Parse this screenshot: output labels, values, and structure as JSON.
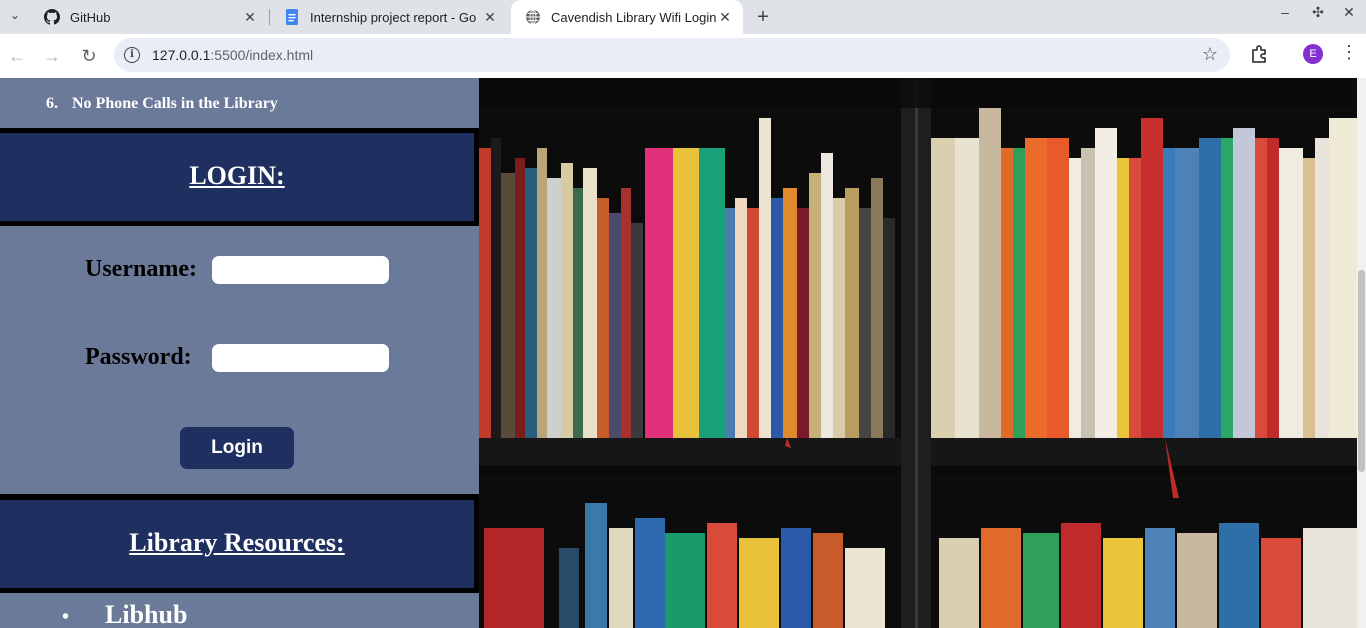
{
  "browser": {
    "tabs": [
      {
        "title": "GitHub",
        "icon": "github-icon"
      },
      {
        "title": "Internship project report - Go",
        "icon": "google-docs-icon"
      },
      {
        "title": "Cavendish Library Wifi Login",
        "icon": "globe-icon",
        "active": true
      }
    ],
    "url_host": "127.0.0.1",
    "url_rest": ":5500/index.html",
    "profile_initial": "E"
  },
  "page": {
    "rules": [
      {
        "number": "6.",
        "text": "No Phone Calls in the Library"
      }
    ],
    "login": {
      "title": "LOGIN:",
      "username_label": "Username:",
      "username_value": "",
      "password_label": "Password:",
      "password_value": "",
      "button_label": "Login"
    },
    "resources": {
      "title": "Library Resources:",
      "items": [
        "Libhub"
      ]
    },
    "colors": {
      "panel_light": "#6c7a9a",
      "panel_dark": "#1f3060",
      "button": "#1f3060"
    }
  }
}
